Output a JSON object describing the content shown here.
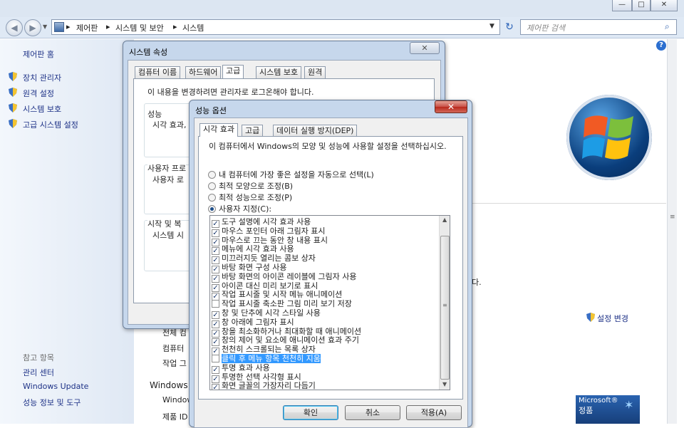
{
  "explorer": {
    "window_buttons": [
      "—",
      "□",
      "✕"
    ],
    "breadcrumbs": [
      "제어판",
      "시스템 및 보안",
      "시스템"
    ],
    "search_placeholder": "제어판 검색",
    "nav": {
      "home": "제어판 홈",
      "links": [
        "장치 관리자",
        "원격 설정",
        "시스템 보호",
        "고급 시스템 설정"
      ],
      "see_also_header": "참고 항목",
      "see_also": [
        "관리 센터",
        "Windows Update",
        "성능 정보 및 도구"
      ]
    },
    "main_fragments": {
      "row1": "전체 컴",
      "row2": "컴퓨터",
      "row3": "작업 그",
      "section": "Windows 정",
      "row4": "Window",
      "row5": "제품 ID",
      "cut_text": "다.",
      "settings_link": "설정 변경",
      "genuine_line1": "Microsoft®",
      "genuine_line2": "정품"
    }
  },
  "system_properties": {
    "title": "시스템 속성",
    "close": "✕",
    "tabs": [
      "컴퓨터 이름",
      "하드웨어",
      "고급",
      "시스템 보호",
      "원격"
    ],
    "active_tab": "고급",
    "admin_note": "이 내용을 변경하려면 관리자로 로그온해야 합니다.",
    "groups": [
      {
        "title": "성능",
        "text": "시각 효과,"
      },
      {
        "title": "사용자 프로",
        "text": "사용자 로"
      },
      {
        "title": "시작 및 복",
        "text": "시스템 시"
      }
    ]
  },
  "performance_options": {
    "title": "성능 옵션",
    "close": "✕",
    "tabs": [
      "시각 효과",
      "고급",
      "데이터 실행 방지(DEP)"
    ],
    "active_tab": "시각 효과",
    "description": "이 컴퓨터에서 Windows의 모양 및 성능에 사용할 설정을 선택하십시오.",
    "radios": [
      {
        "label": "내 컴퓨터에 가장 좋은 설정을 자동으로 선택(L)",
        "checked": false
      },
      {
        "label": "최적 모양으로 조정(B)",
        "checked": false
      },
      {
        "label": "최적 성능으로 조정(P)",
        "checked": false
      },
      {
        "label": "사용자 지정(C):",
        "checked": true
      }
    ],
    "effects": [
      {
        "label": "도구 설명에 시각 효과 사용",
        "checked": true
      },
      {
        "label": "마우스 포인터 아래 그림자 표시",
        "checked": true
      },
      {
        "label": "마우스로 끄는 동안 창 내용 표시",
        "checked": true
      },
      {
        "label": "메뉴에 시각 효과 사용",
        "checked": true
      },
      {
        "label": "미끄러지듯 열리는 콤보 상자",
        "checked": true
      },
      {
        "label": "바탕 화면 구성 사용",
        "checked": true
      },
      {
        "label": "바탕 화면의 아이콘 레이블에 그림자 사용",
        "checked": true
      },
      {
        "label": "아이콘 대신 미리 보기로 표시",
        "checked": true
      },
      {
        "label": "작업 표시줄 및 시작 메뉴 애니메이션",
        "checked": true
      },
      {
        "label": "작업 표시줄 축소판 그림 미리 보기 저장",
        "checked": false
      },
      {
        "label": "창 및 단추에 시각 스타일 사용",
        "checked": true
      },
      {
        "label": "창 아래에 그림자 표시",
        "checked": true
      },
      {
        "label": "창을 최소화하거나 최대화할 때 애니메이션",
        "checked": true
      },
      {
        "label": "창의 제어 및 요소에 애니메이션 효과 주기",
        "checked": true
      },
      {
        "label": "천천히 스크롤되는 목록 상자",
        "checked": true
      },
      {
        "label": "클릭 후 메뉴 항목 천천히 지움",
        "checked": false,
        "selected": true
      },
      {
        "label": "투명 효과 사용",
        "checked": true
      },
      {
        "label": "투명한 선택 사각형 표시",
        "checked": true
      },
      {
        "label": "화면 글꼴의 가장자리 다듬기",
        "checked": true
      }
    ],
    "buttons": {
      "ok": "확인",
      "cancel": "취소",
      "apply": "적용(A)"
    }
  }
}
